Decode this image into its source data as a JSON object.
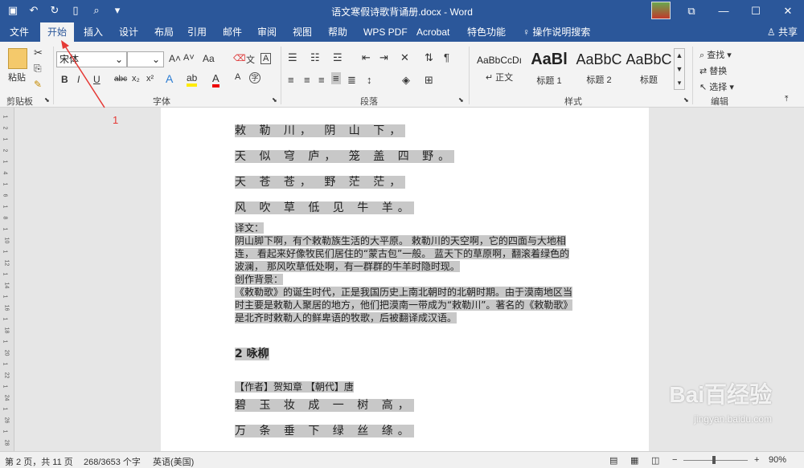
{
  "window": {
    "title": "语文寒假诗歌背诵册.docx - Word",
    "controls": [
      "⧉",
      "—",
      "☐",
      "✕"
    ]
  },
  "quick_access": {
    "save_icon": "save-icon",
    "undo_icon": "undo-icon",
    "redo_icon": "redo-icon",
    "new_icon": "new-doc-icon",
    "preview_icon": "print-preview-icon",
    "more_icon": "customize-icon"
  },
  "tabs": [
    "文件",
    "开始",
    "插入",
    "设计",
    "布局",
    "引用",
    "邮件",
    "审阅",
    "视图",
    "帮助",
    "WPS PDF",
    "Acrobat",
    "特色功能",
    "操作说明搜索"
  ],
  "active_tab": "开始",
  "share_label": "共享",
  "ribbon": {
    "clipboard": {
      "paste_label": "粘贴",
      "group_label": "剪贴板"
    },
    "font": {
      "font_name": "宋体",
      "font_size": "",
      "group_label": "字体",
      "buttons": [
        "B",
        "I",
        "U",
        "abc",
        "x₂",
        "x²",
        "A",
        "A",
        "Aa"
      ]
    },
    "paragraph": {
      "group_label": "段落"
    },
    "styles": {
      "group_label": "样式",
      "items": [
        {
          "sample": "AaBbCcDı",
          "name": "↵ 正文"
        },
        {
          "sample": "AaBl",
          "name": "标题 1"
        },
        {
          "sample": "AaBbC",
          "name": "标题 2"
        },
        {
          "sample": "AaBbC",
          "name": "标题"
        }
      ]
    },
    "editing": {
      "group_label": "编辑",
      "find": "查找",
      "replace": "替换",
      "select": "选择"
    }
  },
  "document": {
    "poem_lines": [
      "敕 勒 川， 阴 山 下，",
      "天 似 穹 庐， 笼 盖 四 野。",
      "天 苍 苍， 野 茫 茫，",
      "风 吹 草 低 见 牛 羊。"
    ],
    "translation_label": "译文：",
    "translation_text": "阴山脚下啊，有个敕勒族生活的大平原。 敕勒川的天空啊，它的四面与大地相连， 看起来好像牧民们居住的“蒙古包”一般。 蓝天下的草原啊，翻滚着绿色的波澜， 那风吹草低处啊，有一群群的牛羊时隐时现。",
    "background_label": "创作背景：",
    "background_text": "《敕勒歌》的诞生时代，正是我国历史上南北朝时的北朝时期。由于漠南地区当时主要是敕勒人聚居的地方，他们把漠南一带成为“敕勒川”。著名的《敕勒歌》是北齐时敕勒人的鲜卑语的牧歌，后被翻译成汉语。",
    "heading": "2 咏柳",
    "author_line": "【作者】贺知章 【朝代】唐",
    "poem2_lines": [
      "碧 玉 妆 成 一 树 高，",
      "万 条 垂 下 绿 丝 绦。"
    ]
  },
  "ruler_ticks": [
    "1",
    "2",
    "1",
    "2",
    "1",
    "4",
    "1",
    "6",
    "1",
    "8",
    "1",
    "10",
    "1",
    "12",
    "1",
    "14",
    "1",
    "16",
    "1",
    "18",
    "1",
    "20",
    "1",
    "22",
    "1",
    "24",
    "1",
    "26",
    "1",
    "28"
  ],
  "status": {
    "page": "第 2 页，共 11 页",
    "words": "268/3653 个字",
    "language": "英语(美国)",
    "zoom": "90%"
  },
  "annotation": "1",
  "watermark": {
    "main": "Bai百经验",
    "sub": "jingyan.baidu.com"
  }
}
